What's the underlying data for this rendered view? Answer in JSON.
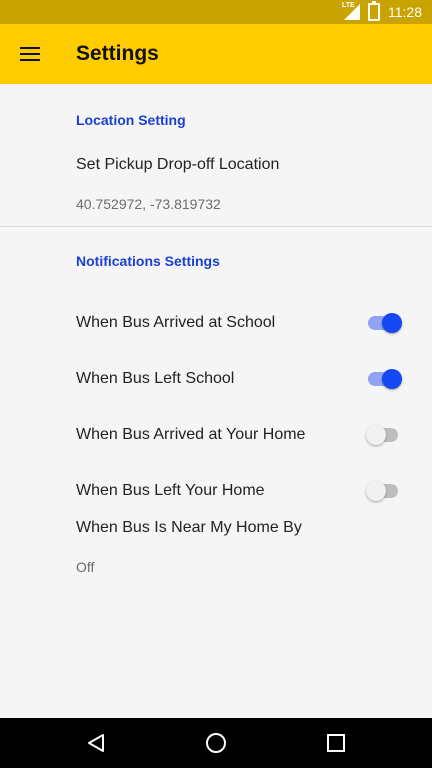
{
  "status_bar": {
    "network": "LTE",
    "time": "11:28"
  },
  "app_bar": {
    "title": "Settings"
  },
  "sections": {
    "location": {
      "header": "Location Setting",
      "items": [
        {
          "title": "Set Pickup Drop-off Location",
          "subtitle": "40.752972, -73.819732"
        }
      ]
    },
    "notifications": {
      "header": "Notifications Settings",
      "items": [
        {
          "title": "When Bus Arrived at School",
          "enabled": true
        },
        {
          "title": "When Bus Left School",
          "enabled": true
        },
        {
          "title": "When Bus Arrived at Your Home",
          "enabled": false
        },
        {
          "title": "When Bus Left Your Home",
          "enabled": false
        },
        {
          "title": "When Bus Is Near My Home By",
          "subtitle": "Off"
        }
      ]
    }
  },
  "icons": {
    "menu": "hamburger-icon",
    "back": "back-triangle-icon",
    "home": "home-circle-icon",
    "recents": "recents-square-icon"
  },
  "colors": {
    "app_bar": "#ffcc00",
    "status_bar": "#c9a400",
    "accent": "#1547f2",
    "section_header": "#1a3fd6"
  }
}
